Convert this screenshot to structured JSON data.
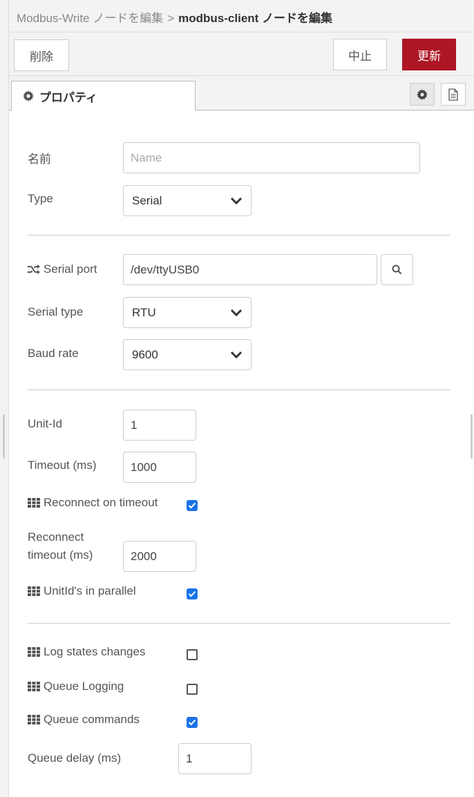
{
  "breadcrumb": {
    "parent": "Modbus-Write ノードを編集",
    "separator": ">",
    "current": "modbus-client ノードを編集"
  },
  "toolbar": {
    "delete_label": "削除",
    "cancel_label": "中止",
    "update_label": "更新",
    "accent_color": "#ad1625"
  },
  "tabs": {
    "properties_label": "プロパティ",
    "properties_icon": "gear-icon",
    "side_icons": [
      "gear-icon",
      "document-icon"
    ]
  },
  "form": {
    "name": {
      "label": "名前",
      "placeholder": "Name",
      "value": ""
    },
    "type": {
      "label": "Type",
      "value": "Serial"
    },
    "serial_port": {
      "label": "Serial port",
      "icon": "shuffle-icon",
      "value": "/dev/ttyUSB0"
    },
    "serial_type": {
      "label": "Serial type",
      "value": "RTU"
    },
    "baud_rate": {
      "label": "Baud rate",
      "value": "9600"
    },
    "unit_id": {
      "label": "Unit-Id",
      "value": "1"
    },
    "timeout": {
      "label": "Timeout (ms)",
      "value": "1000"
    },
    "reconnect_on_timeout": {
      "label": "Reconnect on timeout",
      "icon": "grid-icon",
      "checked": true
    },
    "reconnect_timeout": {
      "label": "Reconnect timeout (ms)",
      "value": "2000"
    },
    "unitids_parallel": {
      "label": "UnitId's in parallel",
      "icon": "grid-icon",
      "checked": true
    },
    "log_states_changes": {
      "label": "Log states changes",
      "icon": "grid-icon",
      "checked": false
    },
    "queue_logging": {
      "label": "Queue Logging",
      "icon": "grid-icon",
      "checked": false
    },
    "queue_commands": {
      "label": "Queue commands",
      "icon": "grid-icon",
      "checked": true
    },
    "queue_delay": {
      "label": "Queue delay (ms)",
      "value": "1"
    }
  },
  "colors": {
    "checkbox_checked": "#1a73e8",
    "panel_bg": "#f3f3f3"
  }
}
